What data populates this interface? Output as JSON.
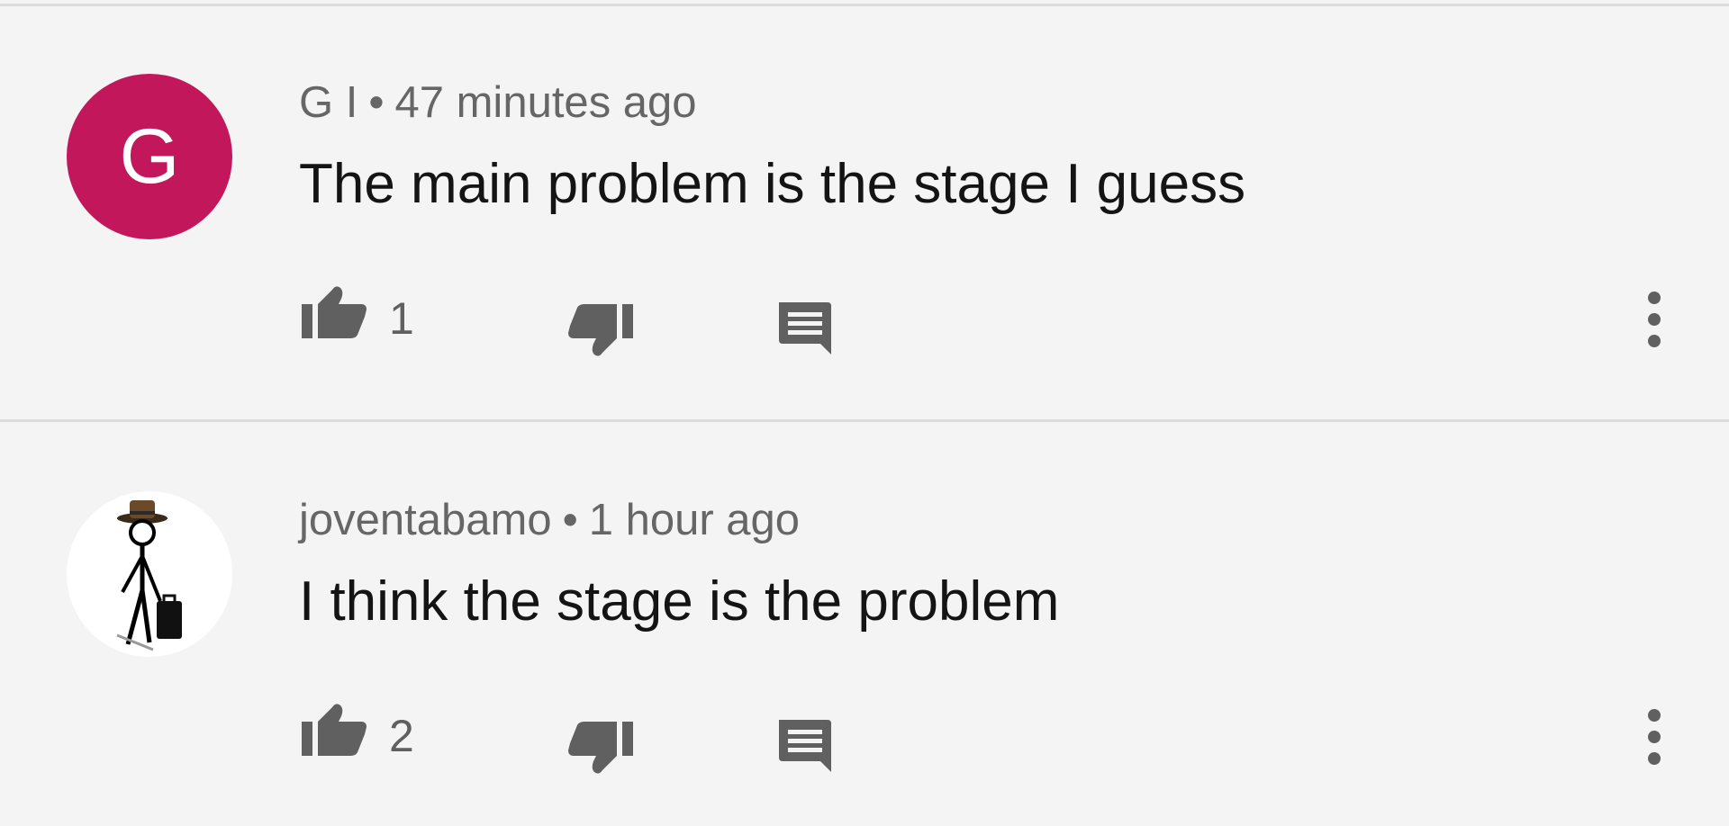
{
  "colors": {
    "background": "#f4f4f4",
    "avatar_g": "#c2185b",
    "icon_gray": "#606060",
    "divider": "#dcdcdc"
  },
  "comments": [
    {
      "avatar_letter": "G",
      "author": "G I",
      "separator": "•",
      "time": "47 minutes ago",
      "text": "The main problem is the stage I guess",
      "likes": "1",
      "icons": [
        "thumb-up-icon",
        "thumb-down-icon",
        "reply-icon",
        "more-vert-icon"
      ]
    },
    {
      "avatar_icon": "stick-figure-avatar",
      "author": "joventabamo",
      "separator": "•",
      "time": "1 hour ago",
      "text": "I think the stage is the problem",
      "likes": "2",
      "icons": [
        "thumb-up-icon",
        "thumb-down-icon",
        "reply-icon",
        "more-vert-icon"
      ]
    }
  ]
}
